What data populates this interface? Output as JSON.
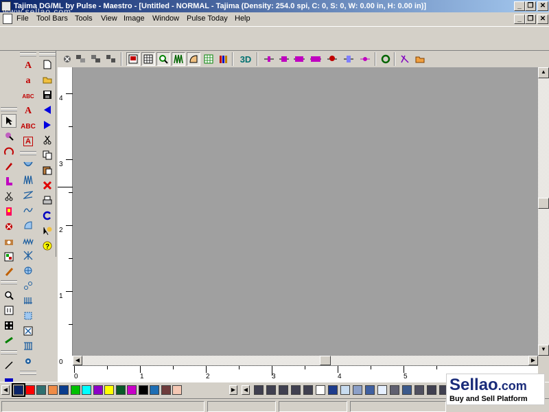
{
  "window": {
    "title": "Tajima DG/ML by Pulse - Maestro - [Untitled - NORMAL - Tajima (Density: 254.0 spi, C: 0, S: 0, W: 0.00 in, H: 0.00 in)]",
    "watermark": "www.sellao.com",
    "buttons": {
      "minimize": "_",
      "restore": "❐",
      "close": "✕"
    }
  },
  "menu": {
    "items": [
      "File",
      "Tool Bars",
      "Tools",
      "View",
      "Image",
      "Window",
      "Pulse Today",
      "Help"
    ]
  },
  "toolbar_top": {
    "text_labels": {
      "three_d": "3D"
    }
  },
  "left_toolbars": {
    "col2_labels": [
      "A",
      "a",
      "ABC",
      "A",
      "ABC",
      "A"
    ]
  },
  "ruler": {
    "left_labels": [
      "4",
      "3",
      "2",
      "1",
      "0"
    ],
    "bottom_labels": [
      "0",
      "1",
      "2",
      "3",
      "4",
      "5"
    ]
  },
  "palette": {
    "colors": [
      "#0a246a",
      "#ff0000",
      "#2f6f6f",
      "#f08c46",
      "#0a3c8c",
      "#00c000",
      "#00ffff",
      "#8c00c8",
      "#ffff00",
      "#0a5a28",
      "#c800c8",
      "#000000",
      "#1e6eb4",
      "#6e3c3c",
      "#f5c8b4"
    ],
    "right_colors": [
      "#404050",
      "#404050",
      "#404050",
      "#404050",
      "#404050",
      "#ffffff",
      "#1e3c8c",
      "#c8dcf0",
      "#8ca0c8",
      "#4060a0",
      "#e6f0ff",
      "#606070",
      "#3c5a8c",
      "#505060",
      "#404050",
      "#404050",
      "#404050"
    ]
  },
  "watermark_logo": {
    "brand": "Sellao",
    "domain": ".com",
    "tagline": "Buy and Sell Platform"
  }
}
